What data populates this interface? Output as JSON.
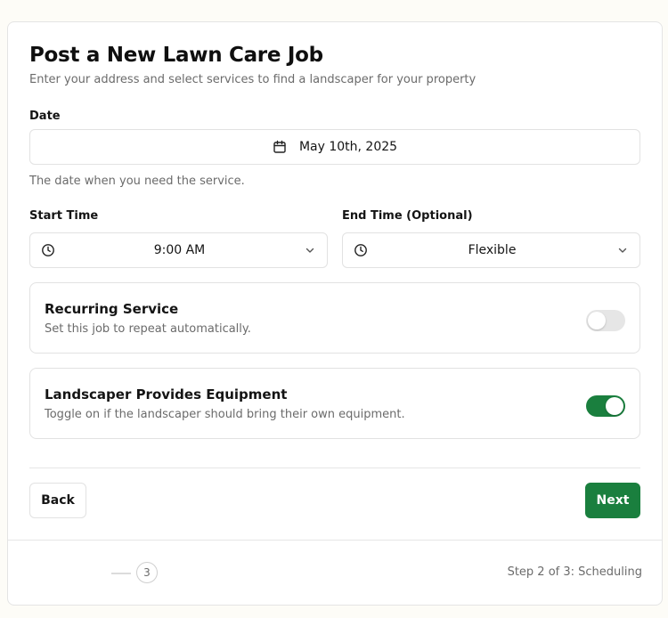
{
  "header": {
    "title": "Post a New Lawn Care Job",
    "subtitle": "Enter your address and select services to find a landscaper for your property"
  },
  "date": {
    "label": "Date",
    "value": "May 10th, 2025",
    "hint": "The date when you need the service.",
    "icon": "calendar-icon"
  },
  "start_time": {
    "label": "Start Time",
    "value": "9:00 AM",
    "icon": "clock-icon"
  },
  "end_time": {
    "label": "End Time (Optional)",
    "value": "Flexible",
    "icon": "clock-icon"
  },
  "recurring": {
    "title": "Recurring Service",
    "description": "Set this job to repeat automatically.",
    "enabled": false
  },
  "equipment": {
    "title": "Landscaper Provides Equipment",
    "description": "Toggle on if the landscaper should bring their own equipment.",
    "enabled": true
  },
  "actions": {
    "back_label": "Back",
    "next_label": "Next"
  },
  "footer": {
    "step_number": "3",
    "step_text": "Step 2 of 3: Scheduling"
  },
  "colors": {
    "accent": "#1a7f3e",
    "toggle_off": "#e6e6e6"
  }
}
